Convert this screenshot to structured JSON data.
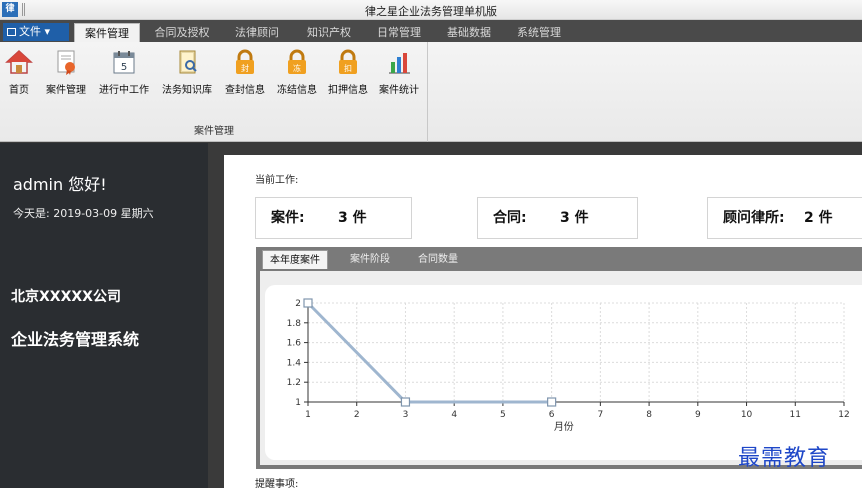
{
  "window": {
    "title": "律之星企业法务管理单机版",
    "app_icon": "律"
  },
  "menu": {
    "file_label": "文件",
    "tabs": [
      {
        "label": "案件管理"
      },
      {
        "label": "合同及授权"
      },
      {
        "label": "法律顾问"
      },
      {
        "label": "知识产权"
      },
      {
        "label": "日常管理"
      },
      {
        "label": "基础数据"
      },
      {
        "label": "系统管理"
      }
    ],
    "active_tab": "案件管理"
  },
  "ribbon": {
    "group_label": "案件管理",
    "buttons": [
      {
        "label": "首页",
        "icon": "home-icon"
      },
      {
        "label": "案件管理",
        "icon": "case-document-icon"
      },
      {
        "label": "进行中工作",
        "icon": "calendar-icon"
      },
      {
        "label": "法务知识库",
        "icon": "knowledge-book-icon"
      },
      {
        "label": "查封信息",
        "icon": "lock-icon"
      },
      {
        "label": "冻结信息",
        "icon": "lock-icon"
      },
      {
        "label": "扣押信息",
        "icon": "lock-icon"
      },
      {
        "label": "案件统计",
        "icon": "bar-chart-icon"
      }
    ],
    "lock_glyphs": [
      "封",
      "冻",
      "扣"
    ]
  },
  "sidebar": {
    "greeting": "admin  您好!",
    "today": "今天是: 2019-03-09  星期六",
    "company": "北京XXXXX公司",
    "system_name": "企业法务管理系统"
  },
  "main": {
    "current_work_label": "当前工作:",
    "stats": [
      {
        "label": "案件:",
        "value": "3 件"
      },
      {
        "label": "合同:",
        "value": "3 件"
      },
      {
        "label": "顾问律所:",
        "value": "2 件"
      }
    ],
    "chart_tabs": [
      {
        "label": "本年度案件"
      },
      {
        "label": "案件阶段"
      },
      {
        "label": "合同数量"
      }
    ],
    "reminder_label": "提醒事项:"
  },
  "colors": {
    "accent": "#1f5fa8",
    "line": "#9fb6cf",
    "sidebar": "#2a2d31",
    "lock": "#f0a020"
  },
  "watermark": "最需教育",
  "chart_data": {
    "type": "line",
    "x": [
      1,
      2,
      3,
      4,
      5,
      6,
      7,
      8,
      9,
      10,
      11,
      12
    ],
    "xticks": [
      "1",
      "2",
      "3",
      "4",
      "5",
      "6",
      "7",
      "8",
      "9",
      "10",
      "11",
      "12"
    ],
    "yticks": [
      "1",
      "1.2",
      "1.4",
      "1.6",
      "1.8",
      "2"
    ],
    "series": [
      {
        "x": [
          1,
          3,
          6
        ],
        "values": [
          2,
          1,
          1
        ]
      }
    ],
    "xlabel": "月份",
    "ylabel": "",
    "xlim": [
      1,
      12
    ],
    "ylim": [
      1,
      2
    ],
    "grid": true
  }
}
